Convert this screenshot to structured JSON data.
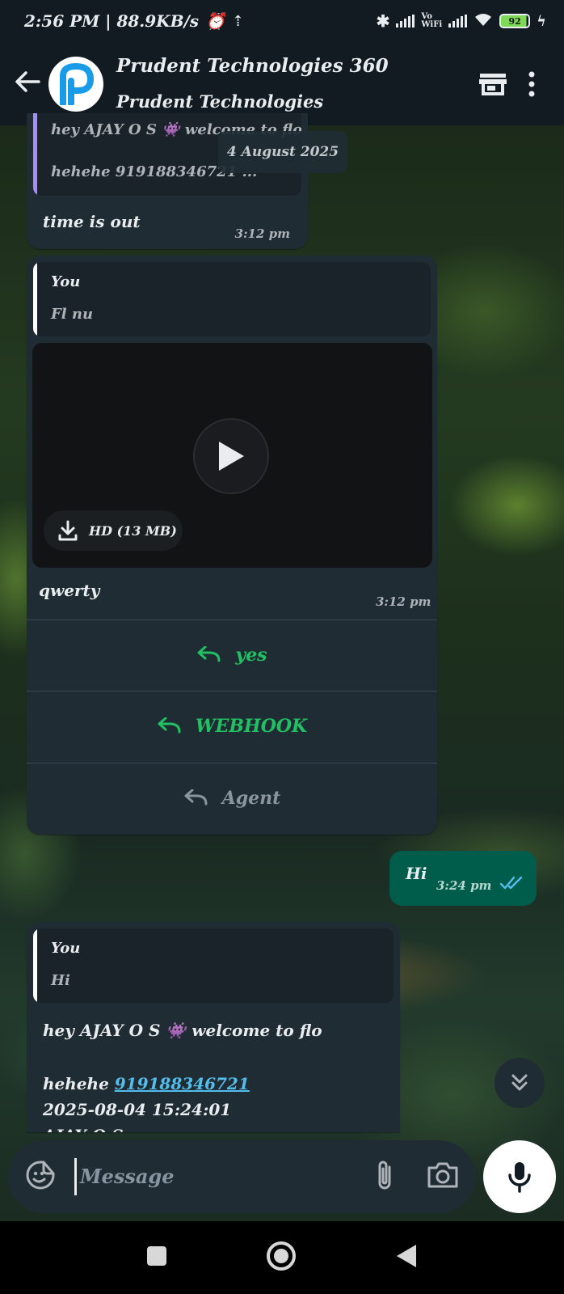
{
  "status_bar": {
    "time_speed": "2:56 PM | 88.9KB/s",
    "vowifi": "Vo\nWiFi",
    "battery": "92"
  },
  "header": {
    "title": "Prudent Technologies 360",
    "subtitle": "Prudent Technologies"
  },
  "chat": {
    "date_chip": "4 August 2025",
    "msg1": {
      "quote_line1": "hey AJAY O S",
      "quote_line1_cont": "welcome to flo",
      "quote_line2": "hehehe 919188346721 ...",
      "text": "time is out",
      "time": "3:12 pm"
    },
    "msg2": {
      "quote_author": "You",
      "quote_text": "Fl nu",
      "video_size": "HD (13 MB)",
      "caption": "qwerty",
      "time": "3:12 pm",
      "quick_replies": [
        "yes",
        "WEBHOOK",
        "Agent"
      ]
    },
    "msg3": {
      "text": "Hi",
      "time": "3:24 pm"
    },
    "msg4": {
      "quote_author": "You",
      "quote_text": "Hi",
      "line1_a": "hey AJAY O S",
      "line1_b": "welcome to flo",
      "line2_a": "hehehe",
      "line2_link": "919188346721",
      "line3": "2025-08-04 15:24:01",
      "line4": "AJAY O S"
    }
  },
  "composer": {
    "placeholder": "Message"
  },
  "colors": {
    "accent_green": "#21c063",
    "sent_bubble": "#005c4b",
    "received_bubble": "#202c33",
    "link": "#53bdeb"
  }
}
